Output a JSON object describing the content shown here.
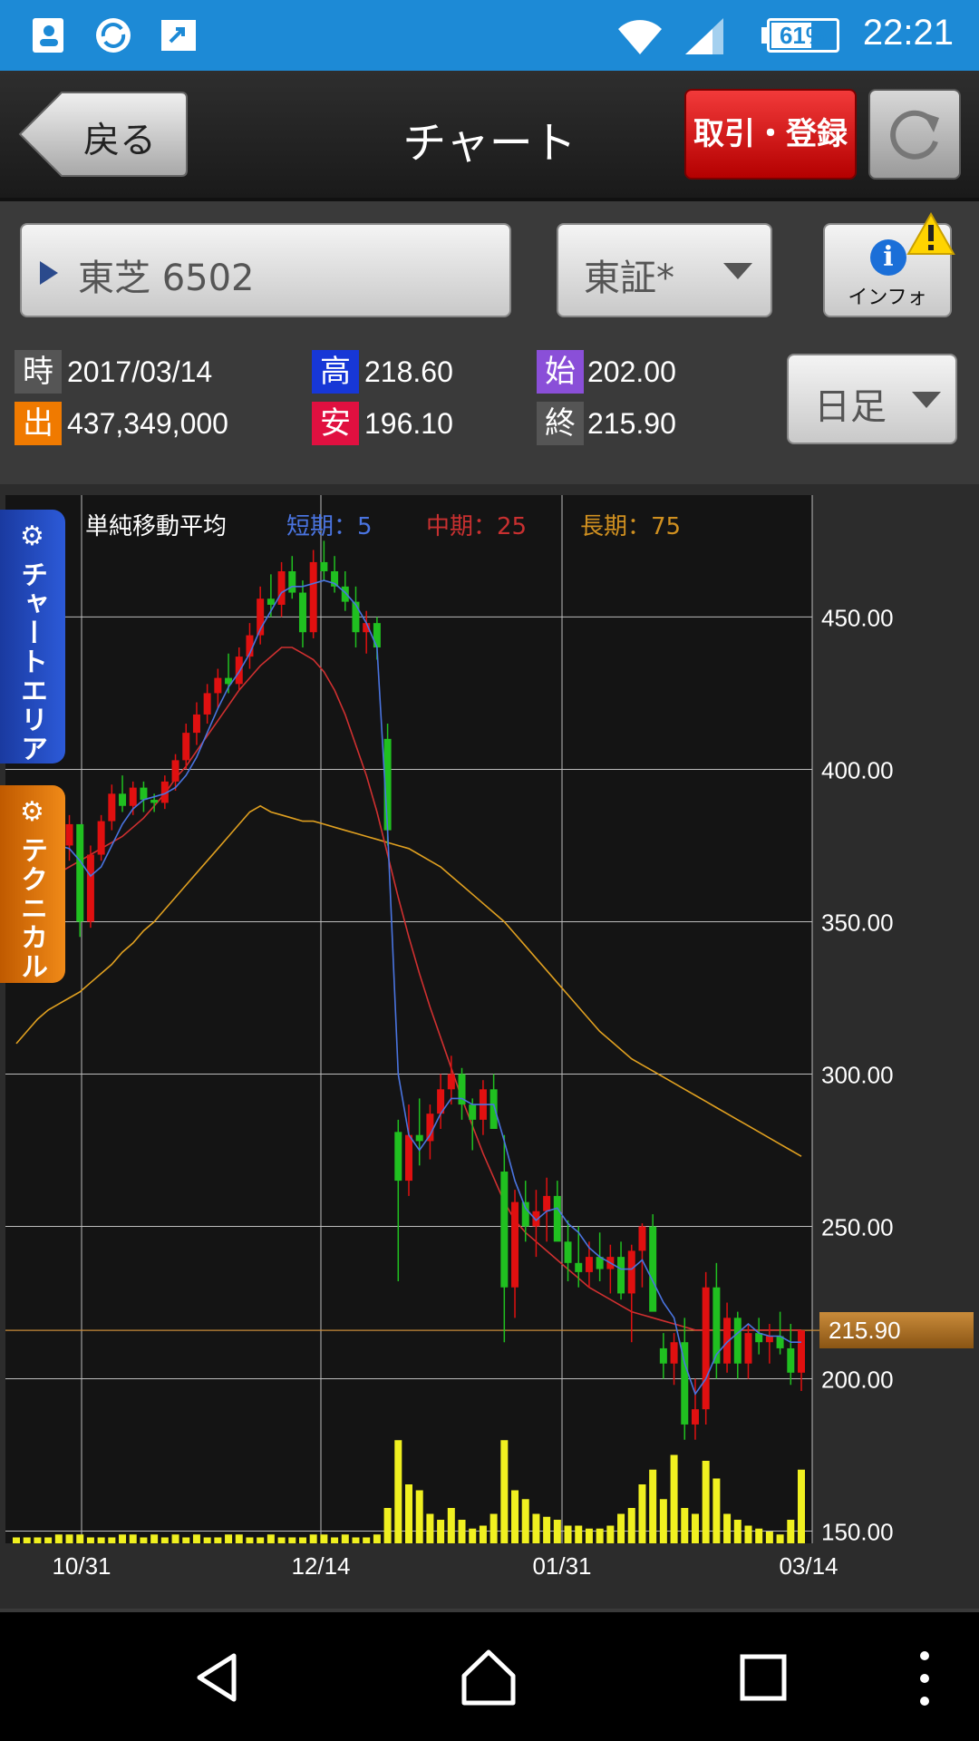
{
  "status_bar": {
    "time": "22:21",
    "battery": "61%",
    "battery_level": 0.61,
    "icons": [
      "contacts-icon",
      "sync-icon",
      "share-icon",
      "wifi-icon",
      "signal-icon",
      "battery-icon"
    ]
  },
  "header": {
    "back_label": "戻る",
    "title": "チャート",
    "trade_label": "取引・登録",
    "refresh_icon": "refresh-icon"
  },
  "selectors": {
    "stock": "東芝 6502",
    "market": "東証*",
    "info_label": "インフォ",
    "period": "日足"
  },
  "quote": {
    "time_badge": "時",
    "time_value": "2017/03/14",
    "volume_badge": "出",
    "volume_value": "437,349,000",
    "high_badge": "高",
    "high_value": "218.60",
    "low_badge": "安",
    "low_value": "196.10",
    "open_badge": "始",
    "open_value": "202.00",
    "close_badge": "終",
    "close_value": "215.90",
    "badge_colors": {
      "time": "#555555",
      "volume": "#f07a00",
      "high": "#1737d6",
      "low": "#e01040",
      "open": "#8a4fd8",
      "close": "#555555"
    }
  },
  "side_tabs": {
    "chart_area": "チャートエリア",
    "technical": "テクニカル"
  },
  "chart_data": {
    "type": "candlestick",
    "legend": {
      "title": "単純移動平均",
      "short": "短期：5",
      "mid": "中期：25",
      "long": "長期：75"
    },
    "colors": {
      "short": "#4a74e0",
      "mid": "#d03030",
      "long": "#e0a020",
      "up": "#e01010",
      "down": "#20c020",
      "volume": "#f0f020"
    },
    "y_ticks": [
      "450.00",
      "400.00",
      "350.00",
      "300.00",
      "250.00",
      "200.00",
      "150.00"
    ],
    "y_tick_values": [
      450,
      400,
      350,
      300,
      250,
      200,
      150
    ],
    "ylim": [
      146,
      490
    ],
    "x_ticks": [
      "10/31",
      "12/14",
      "01/31",
      "03/14"
    ],
    "last_price": "215.90",
    "last_price_value": 215.9,
    "candles": [
      [
        380,
        384,
        374,
        378
      ],
      [
        378,
        386,
        375,
        383
      ],
      [
        383,
        390,
        377,
        385
      ],
      [
        385,
        389,
        370,
        372
      ],
      [
        372,
        378,
        360,
        375
      ],
      [
        375,
        385,
        370,
        382
      ],
      [
        382,
        380,
        345,
        350
      ],
      [
        350,
        375,
        348,
        372
      ],
      [
        372,
        385,
        370,
        383
      ],
      [
        383,
        395,
        380,
        392
      ],
      [
        392,
        398,
        386,
        388
      ],
      [
        388,
        396,
        385,
        394
      ],
      [
        394,
        396,
        386,
        390
      ],
      [
        390,
        392,
        386,
        389
      ],
      [
        389,
        398,
        387,
        396
      ],
      [
        396,
        405,
        393,
        403
      ],
      [
        403,
        415,
        400,
        412
      ],
      [
        412,
        422,
        408,
        418
      ],
      [
        418,
        428,
        415,
        425
      ],
      [
        425,
        433,
        420,
        430
      ],
      [
        430,
        438,
        425,
        428
      ],
      [
        428,
        440,
        426,
        437
      ],
      [
        437,
        448,
        433,
        444
      ],
      [
        444,
        460,
        441,
        456
      ],
      [
        456,
        464,
        450,
        454
      ],
      [
        454,
        468,
        450,
        465
      ],
      [
        465,
        470,
        456,
        458
      ],
      [
        458,
        462,
        440,
        445
      ],
      [
        445,
        472,
        443,
        468
      ],
      [
        468,
        475,
        462,
        465
      ],
      [
        465,
        470,
        458,
        460
      ],
      [
        460,
        465,
        452,
        455
      ],
      [
        455,
        460,
        440,
        445
      ],
      [
        445,
        452,
        438,
        448
      ],
      [
        448,
        450,
        436,
        440
      ],
      [
        410,
        415,
        375,
        380
      ],
      [
        281,
        285,
        232,
        265
      ],
      [
        265,
        290,
        260,
        280
      ],
      [
        280,
        292,
        270,
        278
      ],
      [
        278,
        290,
        272,
        287
      ],
      [
        287,
        300,
        282,
        295
      ],
      [
        295,
        306,
        290,
        300
      ],
      [
        300,
        302,
        285,
        290
      ],
      [
        290,
        292,
        275,
        285
      ],
      [
        285,
        298,
        280,
        295
      ],
      [
        295,
        300,
        288,
        282
      ],
      [
        268,
        280,
        212,
        230
      ],
      [
        230,
        262,
        220,
        258
      ],
      [
        258,
        265,
        245,
        250
      ],
      [
        250,
        262,
        240,
        255
      ],
      [
        255,
        266,
        245,
        260
      ],
      [
        260,
        265,
        250,
        245
      ],
      [
        245,
        252,
        232,
        238
      ],
      [
        238,
        250,
        230,
        235
      ],
      [
        235,
        245,
        230,
        240
      ],
      [
        240,
        248,
        232,
        236
      ],
      [
        236,
        244,
        228,
        240
      ],
      [
        240,
        245,
        226,
        228
      ],
      [
        228,
        244,
        212,
        242
      ],
      [
        242,
        251,
        230,
        250
      ],
      [
        250,
        254,
        232,
        222
      ],
      [
        210,
        215,
        200,
        205
      ],
      [
        205,
        215,
        198,
        212
      ],
      [
        212,
        220,
        180,
        185
      ],
      [
        185,
        200,
        180,
        190
      ],
      [
        190,
        235,
        185,
        230
      ],
      [
        230,
        238,
        200,
        205
      ],
      [
        205,
        225,
        202,
        220
      ],
      [
        220,
        222,
        200,
        205
      ],
      [
        205,
        218,
        200,
        215
      ],
      [
        215,
        220,
        208,
        212
      ],
      [
        212,
        218,
        205,
        214
      ],
      [
        214,
        222,
        208,
        210
      ],
      [
        210,
        218,
        198,
        202
      ],
      [
        202,
        215,
        196,
        215.9
      ]
    ],
    "volumes": [
      2,
      2,
      2,
      2,
      3,
      3,
      3,
      2,
      2,
      2,
      3,
      3,
      2,
      3,
      2,
      3,
      2,
      3,
      2,
      2,
      3,
      3,
      2,
      2,
      3,
      2,
      2,
      2,
      3,
      3,
      2,
      3,
      2,
      2,
      3,
      12,
      35,
      20,
      18,
      10,
      8,
      12,
      8,
      5,
      6,
      10,
      35,
      18,
      15,
      10,
      9,
      8,
      6,
      6,
      5,
      5,
      6,
      10,
      12,
      20,
      25,
      15,
      30,
      12,
      10,
      28,
      22,
      10,
      8,
      6,
      5,
      4,
      3,
      8,
      25
    ],
    "sma5": [
      380,
      381,
      380,
      376,
      375,
      374,
      370,
      365,
      368,
      375,
      382,
      387,
      390,
      391,
      392,
      394,
      398,
      404,
      412,
      420,
      427,
      432,
      438,
      446,
      452,
      458,
      460,
      460,
      461,
      462,
      461,
      458,
      454,
      448,
      440,
      380,
      300,
      280,
      275,
      280,
      287,
      292,
      292,
      290,
      290,
      290,
      278,
      265,
      256,
      252,
      255,
      256,
      251,
      248,
      243,
      240,
      238,
      236,
      236,
      239,
      232,
      225,
      220,
      205,
      195,
      200,
      208,
      212,
      215,
      218,
      215,
      214,
      214,
      212,
      212
    ],
    "sma25": [
      355,
      358,
      361,
      364,
      366,
      368,
      370,
      372,
      374,
      376,
      378,
      381,
      384,
      388,
      392,
      397,
      401,
      406,
      411,
      416,
      421,
      426,
      430,
      434,
      437,
      440,
      440,
      438,
      436,
      432,
      426,
      418,
      408,
      398,
      386,
      372,
      358,
      345,
      333,
      322,
      312,
      302,
      292,
      283,
      274,
      266,
      258,
      252,
      248,
      245,
      242,
      239,
      236,
      233,
      230,
      228,
      226,
      224,
      222,
      221,
      220,
      219,
      218,
      217,
      216,
      216,
      216,
      216,
      216,
      216,
      216,
      216,
      216,
      216,
      216
    ],
    "sma75": [
      310,
      314,
      318,
      321,
      323,
      325,
      327,
      330,
      333,
      336,
      340,
      343,
      347,
      350,
      354,
      358,
      362,
      366,
      370,
      374,
      378,
      382,
      386,
      388,
      386,
      385,
      384,
      383,
      383,
      382,
      381,
      380,
      379,
      378,
      377,
      376,
      375,
      374,
      372,
      370,
      368,
      365,
      362,
      359,
      356,
      353,
      350,
      346,
      342,
      338,
      334,
      330,
      326,
      322,
      318,
      314,
      311,
      308,
      305,
      303,
      301,
      299,
      297,
      295,
      293,
      291,
      289,
      287,
      285,
      283,
      281,
      279,
      277,
      275,
      273
    ]
  }
}
